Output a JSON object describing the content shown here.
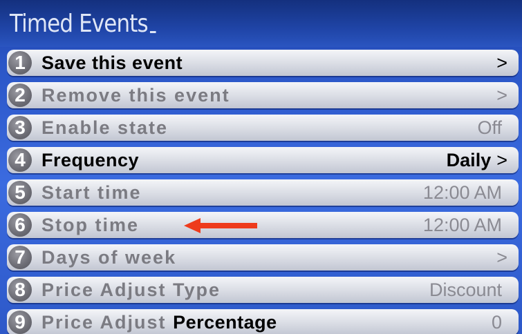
{
  "window": {
    "title": "Timed Events"
  },
  "menu": {
    "items": [
      {
        "number": "1",
        "label": "Save this event",
        "label_extra": "",
        "value": "",
        "chevron": ">",
        "active": true
      },
      {
        "number": "2",
        "label": "Remove this event",
        "label_extra": "",
        "value": "",
        "chevron": ">",
        "active": false
      },
      {
        "number": "3",
        "label": "Enable state",
        "label_extra": "",
        "value": "Off",
        "chevron": "",
        "active": false
      },
      {
        "number": "4",
        "label": "Frequency",
        "label_extra": "",
        "value": "Daily",
        "chevron": ">",
        "active": true
      },
      {
        "number": "5",
        "label": "Start time",
        "label_extra": "",
        "value": "12:00 AM",
        "chevron": "",
        "active": false
      },
      {
        "number": "6",
        "label": "Stop time",
        "label_extra": "",
        "value": "12:00 AM",
        "chevron": "",
        "active": false
      },
      {
        "number": "7",
        "label": "Days of week",
        "label_extra": "",
        "value": "",
        "chevron": ">",
        "active": false
      },
      {
        "number": "8",
        "label": "Price Adjust Type",
        "label_extra": "",
        "value": "Discount",
        "chevron": "",
        "active": false
      },
      {
        "number": "9",
        "label": "Price Adjust",
        "label_extra": "Percentage",
        "value": "0",
        "chevron": "",
        "active": false
      }
    ]
  },
  "annotation": {
    "icon": "red-left-arrow",
    "color": "#ee3b1c"
  },
  "colors": {
    "title_bar": "#1f44a6",
    "row_active_text": "#000000",
    "row_inactive_text": "#7b7b82"
  }
}
